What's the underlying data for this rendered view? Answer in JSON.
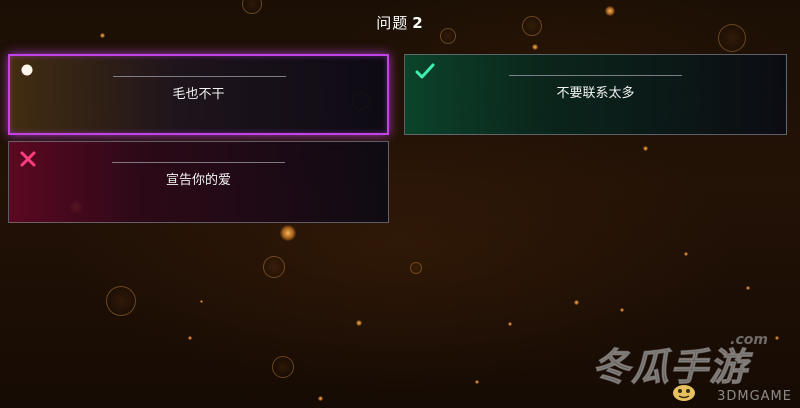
{
  "header": {
    "prefix": "问题",
    "number": "2"
  },
  "options": [
    {
      "text": "毛也不干",
      "state": "selected",
      "icon": "circle-dot-icon",
      "color": "#c243e6"
    },
    {
      "text": "不要联系太多",
      "state": "correct",
      "icon": "checkmark-icon",
      "color": "#2ee0a0"
    },
    {
      "text": "宣告你的爱",
      "state": "wrong",
      "icon": "x-mark-icon",
      "color": "#ff2f78"
    }
  ],
  "watermark": {
    "main": "冬瓜手游",
    "domain": ".com",
    "sub": "3DMGAME"
  }
}
